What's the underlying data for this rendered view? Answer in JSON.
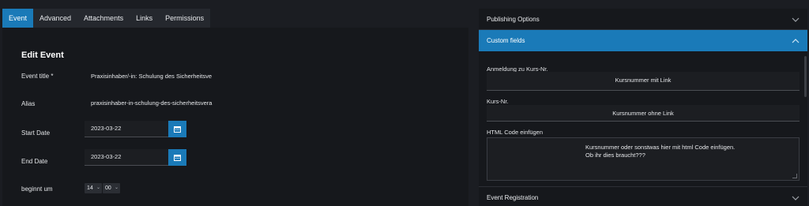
{
  "tabs": [
    {
      "label": "Event",
      "active": true
    },
    {
      "label": "Advanced"
    },
    {
      "label": "Attachments"
    },
    {
      "label": "Links"
    },
    {
      "label": "Permissions"
    }
  ],
  "form": {
    "title": "Edit Event",
    "event_title_label": "Event title *",
    "event_title_value": "Praxisinhaber/-in: Schulung des Sicherheitsve",
    "alias_label": "Alias",
    "alias_value": "praxisinhaber-in-schulung-des-sicherheitsvera",
    "start_date_label": "Start Date",
    "start_date_value": "2023-03-22",
    "end_date_label": "End Date",
    "end_date_value": "2023-03-22",
    "begins_label": "beginnt um",
    "begins_hour": "14",
    "begins_minute": "00"
  },
  "sidebar": {
    "publishing_options": "Publishing Options",
    "custom_fields": "Custom fields",
    "field1_label": "Anmeldung zu Kurs-Nr.",
    "field1_value": "Kursnummer mit Link",
    "field2_label": "Kurs-Nr.",
    "field2_value": "Kursnummer ohne Link",
    "field3_label": "HTML Code einfügen",
    "field3_line1": "Kursnummer oder sonstwas hier mit html Code einfügen.",
    "field3_line2": "Ob ihr dies braucht???",
    "event_registration": "Event Registration"
  },
  "colors": {
    "accent": "#1a7ab8",
    "background": "#1b1d22",
    "panel": "#16181c"
  }
}
